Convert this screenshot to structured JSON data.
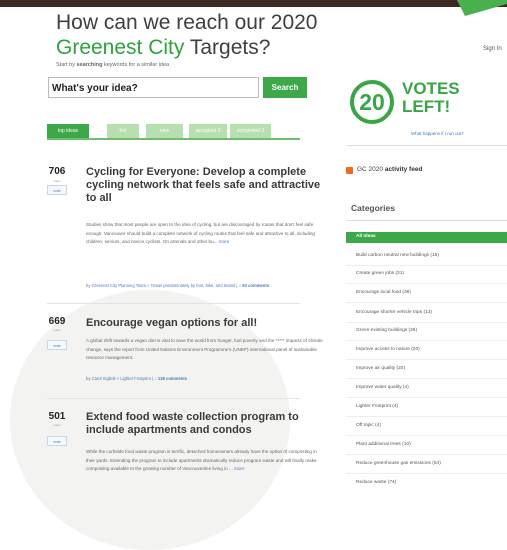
{
  "header": {
    "title_part1": "How can we reach our 2020",
    "title_green": "Greenest City",
    "title_part2": " Targets?",
    "sign_in": "Sign In"
  },
  "search": {
    "hint_prefix": "Start by ",
    "hint_bold": "searching",
    "hint_suffix": " keywords for a similar idea",
    "value": "What's your idea?",
    "button_label": "Search"
  },
  "tabs": [
    {
      "label": "top ideas",
      "active": true
    },
    {
      "label": "hot",
      "active": false
    },
    {
      "label": "new",
      "active": false
    },
    {
      "label": "accepted 3",
      "active": false
    },
    {
      "label": "completed 3",
      "active": false
    }
  ],
  "ideas": [
    {
      "votes": "706",
      "votes_word": "votes",
      "vote_button": "vote",
      "title": "Cycling for Everyone: Develop a complete cycling network that feels safe and attractive to all",
      "body": "Studies show that most people are open to the idea of cycling, but are discouraged by routes that don't feel safe enough. Vancouver should build a complete network of cycling routes that feel safe and attractive to all, including children, seniors, and novice cyclists. On arterials and other bu...",
      "more": "more",
      "meta_by": "by ",
      "author": "Greenest City Planning Team",
      "sep": " » ",
      "category": "Travel predominately by foot, bike, and transit",
      "sep2": " | ",
      "comments": "93 comments"
    },
    {
      "votes": "669",
      "votes_word": "votes",
      "vote_button": "vote",
      "title": "Encourage vegan options for all!",
      "body": "A global shift towards a vegan diet is vital to save the world from hunger, fuel poverty and the ***** impacts of climate change, says the report from United Nations Environment Programme's (UNEP) international panel of sustainable resource management.",
      "more": "",
      "meta_by": "by ",
      "author": "Carol Sigbolt",
      "sep": " » ",
      "category": "Lighter Footprint",
      "sep2": " | ",
      "comments": "128 comments"
    },
    {
      "votes": "501",
      "votes_word": "votes",
      "vote_button": "vote",
      "title": "Extend food waste collection program to include apartments and condos",
      "body": "While the curbside food waste program is terrific, detached homeowners already have the option of composting in their yards. Extending the program to include apartments dramatically reduce program waste and will finally make composting available to the growing number of Vancouverites living in ...",
      "more": "more",
      "meta_by": "",
      "author": "",
      "sep": "",
      "category": "",
      "sep2": "",
      "comments": ""
    }
  ],
  "sidebar": {
    "votes_number": "20",
    "votes_line1": "VOTES",
    "votes_line2": "LEFT!",
    "votes_link": "What happens if I run out?",
    "feed_prefix": "GC 2020 ",
    "feed_bold": "activity feed",
    "categories_heading": "Categories",
    "categories": [
      "All Ideas",
      "Build carbon neutral new buildings (15)",
      "Create green jobs (31)",
      "Encourage local food (38)",
      "Encourage shorter vehicle trips (13)",
      "Green existing buildings (26)",
      "Improve access to nature (20)",
      "Improve air quality (20)",
      "Improve water quality (4)",
      "Lighter Footprint (4)",
      "Off topic (4)",
      "Plant additional trees (10)",
      "Reduce greenhouse gas emissions (54)",
      "Reduce waste (74)"
    ]
  },
  "colors": {
    "brand_green": "#3da84a",
    "link_blue": "#4a7bb7",
    "rss_orange": "#f26b1d"
  }
}
